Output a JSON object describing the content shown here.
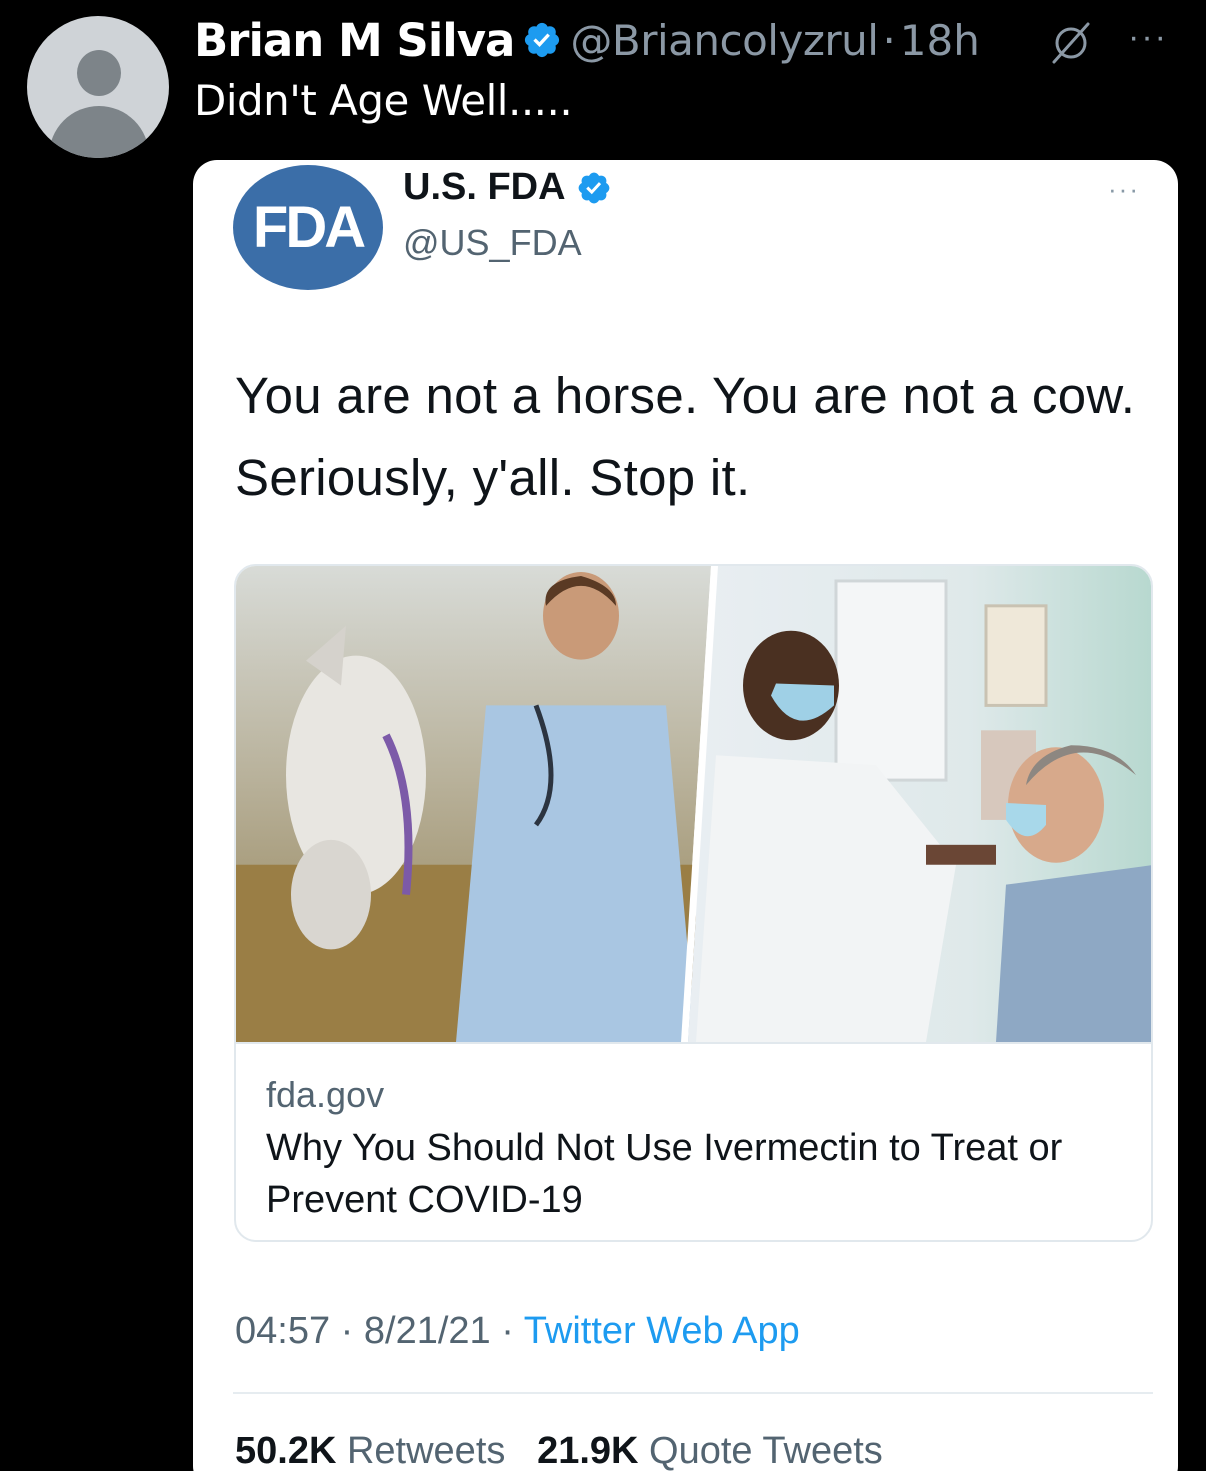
{
  "outer_tweet": {
    "author_name": "Brian M Silva",
    "handle": "@Briancolyzrul",
    "separator": "·",
    "time": "18h",
    "text": "Didn't Age Well.....",
    "more_glyph": "···"
  },
  "embedded_tweet": {
    "logo_text": "FDA",
    "author_name": "U.S. FDA",
    "handle": "@US_FDA",
    "more_glyph": "···",
    "text": "You are not a horse. You are not a cow. Seriously, y'all. Stop it.",
    "link_card": {
      "domain": "fda.gov",
      "title": "Why You Should Not Use Ivermectin to Treat or Prevent COVID-19"
    },
    "meta": {
      "time": "04:57",
      "date": "8/21/21",
      "separator": "·",
      "source": "Twitter Web App"
    },
    "stats": {
      "retweets_count": "50.2K",
      "retweets_label": "Retweets",
      "quotes_count": "21.9K",
      "quotes_label": "Quote Tweets"
    }
  },
  "colors": {
    "verified_blue": "#1d9bf0",
    "fda_blue": "#3b6ea8",
    "secondary_text": "#8b98a5"
  },
  "icons": [
    "avatar",
    "verified-badge-icon",
    "grok-icon",
    "more-icon",
    "fda-logo"
  ]
}
